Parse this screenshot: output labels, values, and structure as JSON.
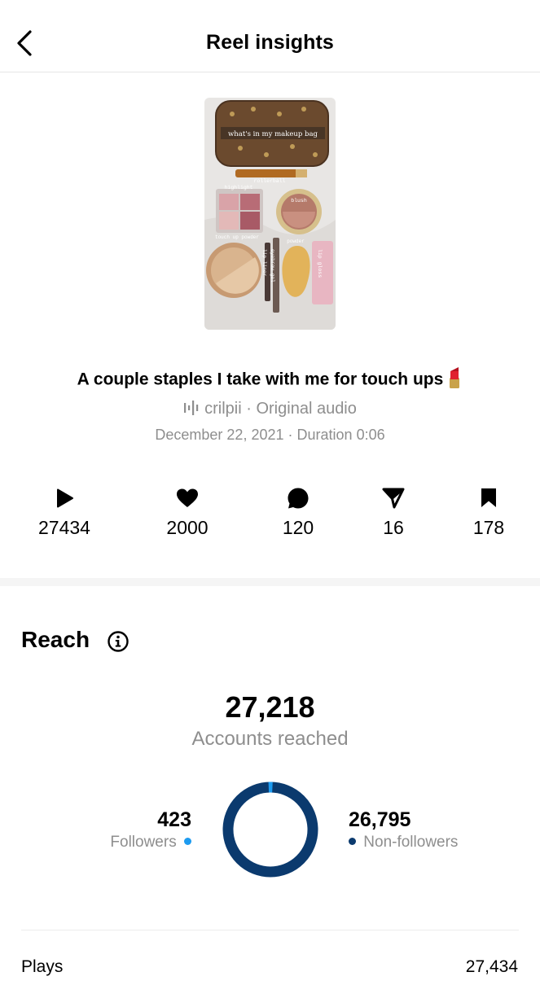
{
  "header": {
    "title": "Reel insights"
  },
  "thumbnail": {
    "labels": {
      "title": "what's in my makeup bag",
      "rollerball": "rollerball",
      "highlight": "highlight",
      "blush": "blush",
      "touch_up_powder": "touch up powder",
      "powder": "powder",
      "lip_liner": "lip liner",
      "eyebrow_gel": "eyebrow gel",
      "lip_gloss": "lip gloss"
    }
  },
  "caption": "A couple staples I take with me for touch ups",
  "audio": {
    "username": "crilpii",
    "separator": "·",
    "track": "Original audio"
  },
  "meta": {
    "date": "December 22, 2021",
    "separator": "·",
    "duration": "Duration 0:06"
  },
  "stats": {
    "plays": "27434",
    "likes": "2000",
    "comments": "120",
    "shares": "16",
    "saves": "178"
  },
  "reach": {
    "title": "Reach",
    "accounts_reached": "27,218",
    "accounts_reached_label": "Accounts reached",
    "followers": {
      "value": "423",
      "label": "Followers",
      "color": "#1d9bf0"
    },
    "non_followers": {
      "value": "26,795",
      "label": "Non-followers",
      "color": "#0b3a6e"
    },
    "followers_share": 0.0155
  },
  "plays_row": {
    "label": "Plays",
    "value": "27,434"
  }
}
